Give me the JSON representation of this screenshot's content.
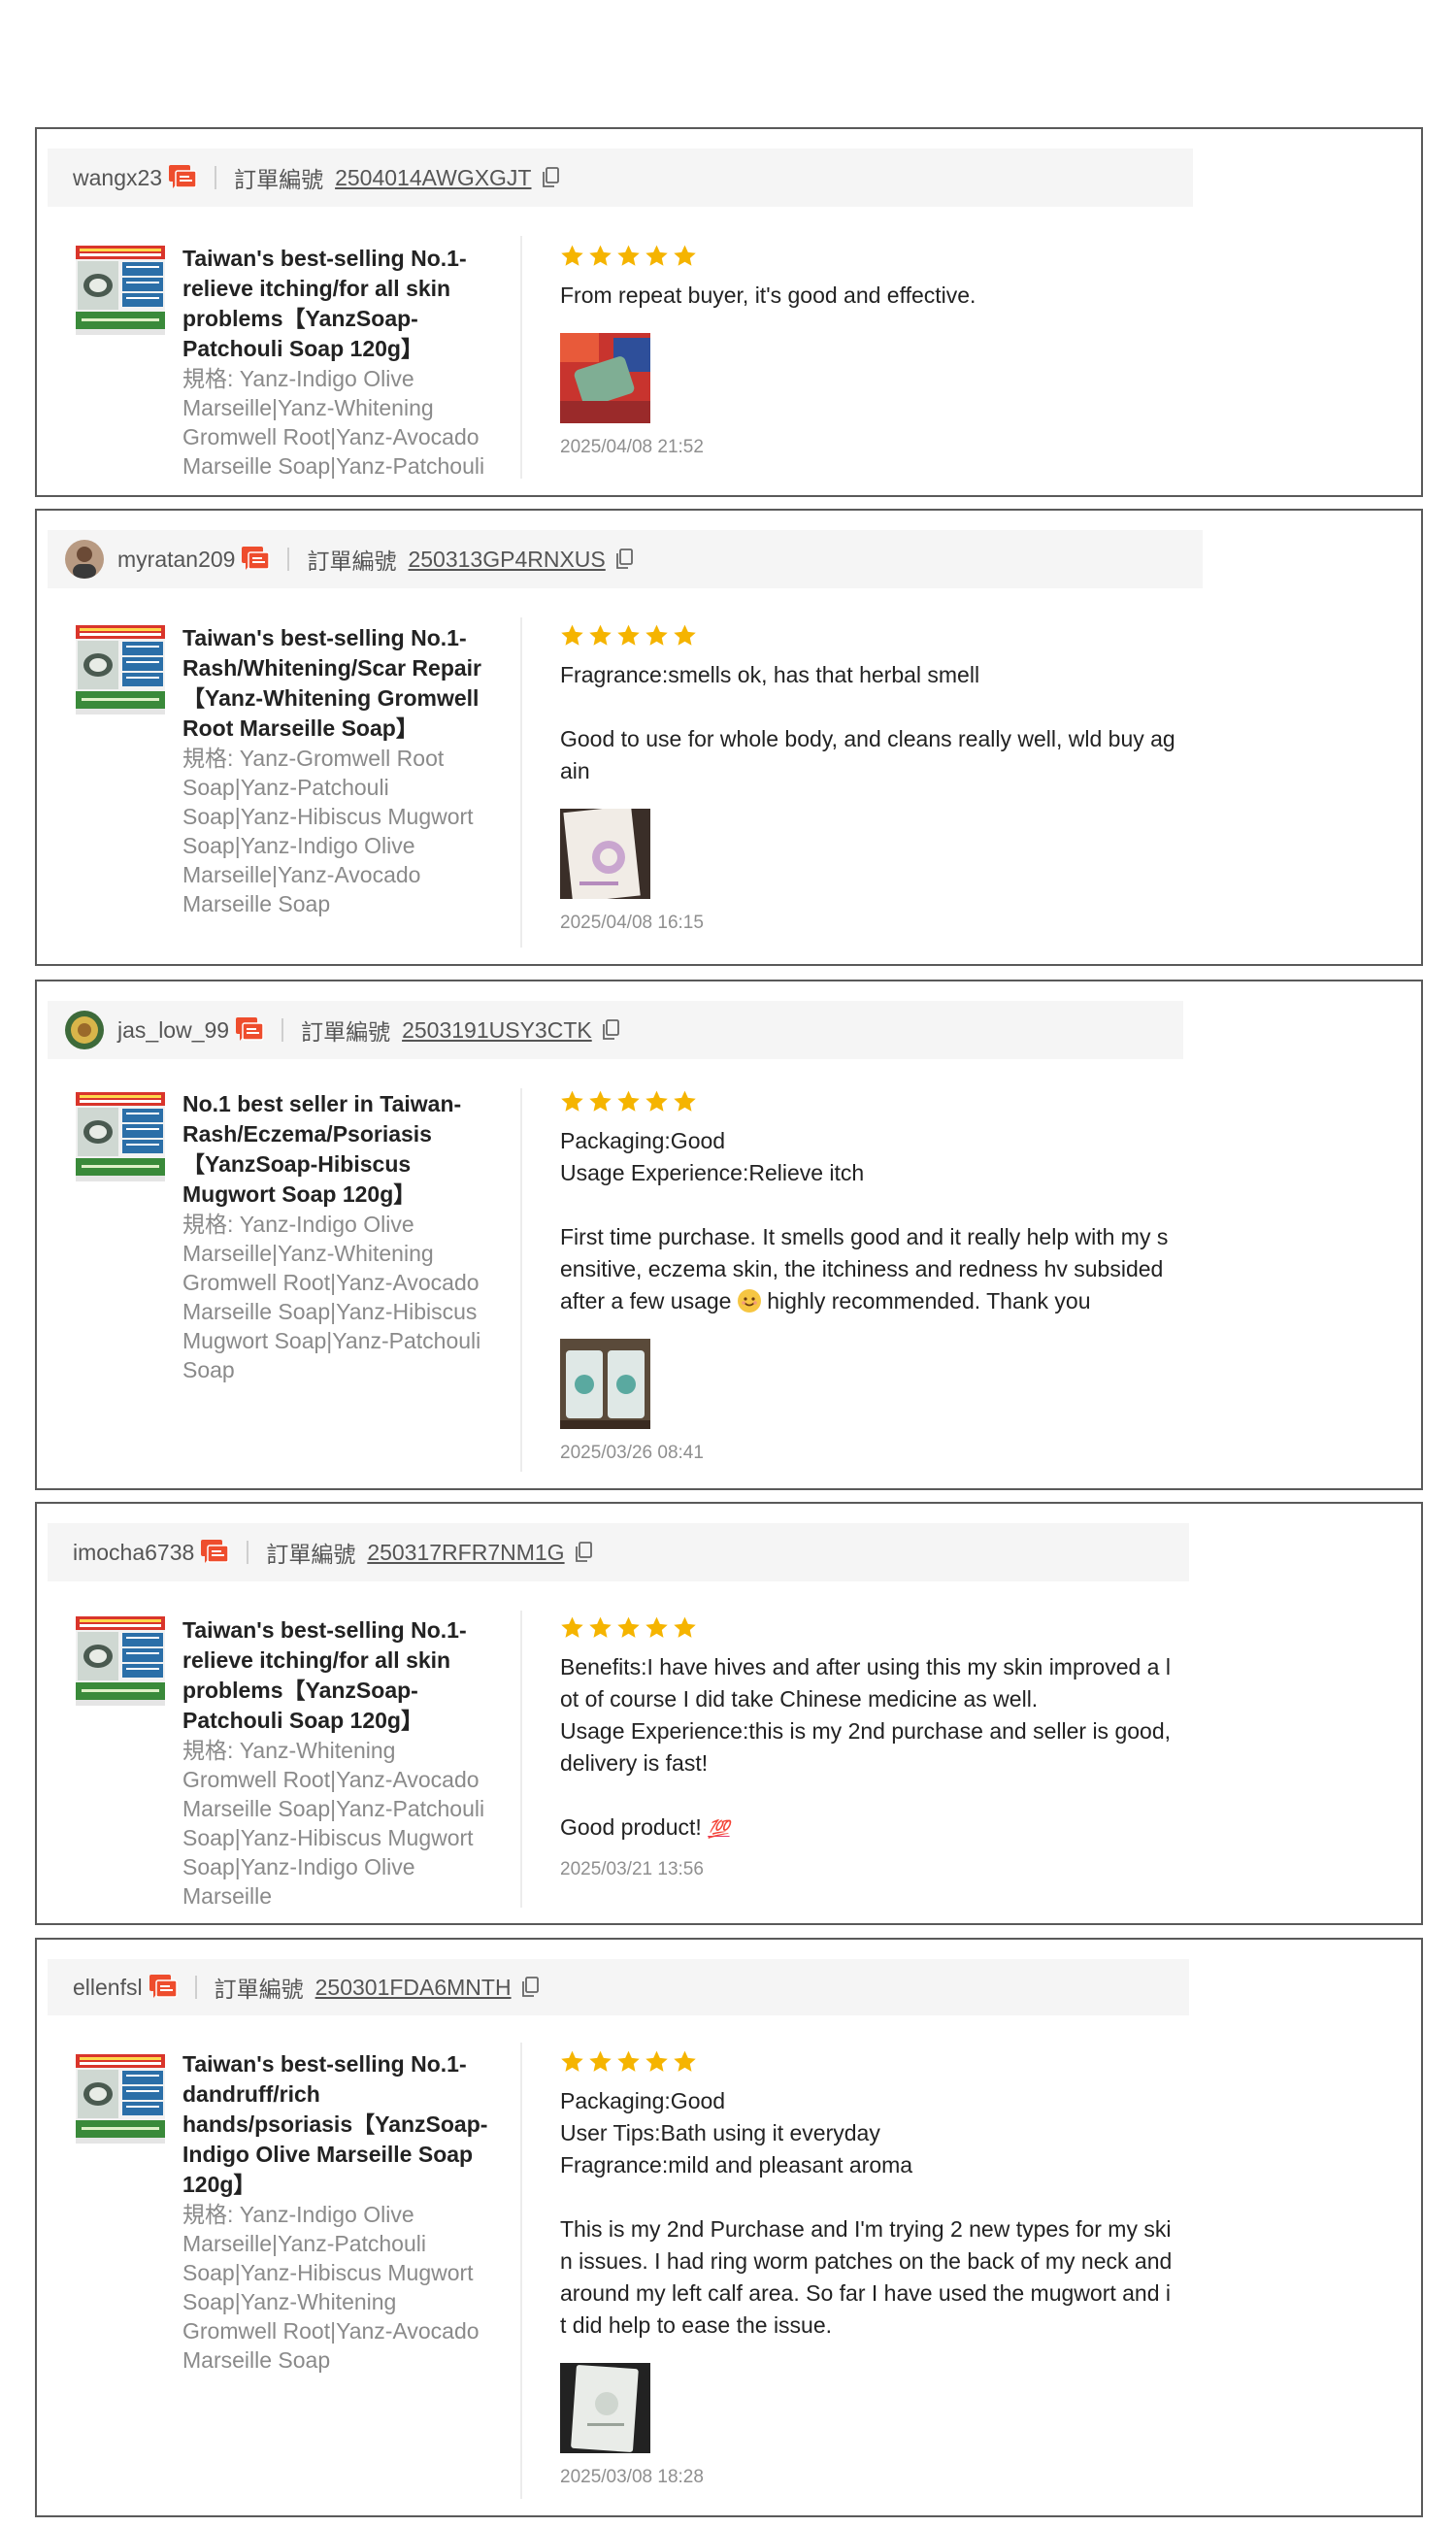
{
  "order_label": "訂單編號",
  "reviews": [
    {
      "username": "wangx23",
      "order_id": "2504014AWGXGJT",
      "product_name": "Taiwan's best-selling No.1-relieve itching/for all skin problems【YanzSoap-Patchouli Soap 120g】",
      "variation": "規格: Yanz-Indigo Olive Marseille|Yanz-Whitening Gromwell Root|Yanz-Avocado Marseille Soap|Yanz-Patchouli Soap|Ya",
      "rating": 5,
      "text": "From repeat buyer, it's good and effective.",
      "date": "2025/04/08 21:52"
    },
    {
      "username": "myratan209",
      "order_id": "250313GP4RNXUS",
      "product_name": "Taiwan's best-selling No.1-Rash/Whitening/Scar Repair【Yanz-Whitening Gromwell Root Marseille Soap】",
      "variation": "規格: Yanz-Gromwell Root Soap|Yanz-Patchouli Soap|Yanz-Hibiscus Mugwort Soap|Yanz-Indigo Olive Marseille|Yanz-Avocado Marseille Soap",
      "rating": 5,
      "text": "Fragrance:smells ok, has that herbal smell\n\nGood to use for whole body, and cleans really well, wld buy again",
      "date": "2025/04/08 16:15"
    },
    {
      "username": "jas_low_99",
      "order_id": "2503191USY3CTK",
      "product_name": "No.1 best seller in Taiwan-Rash/Eczema/Psoriasis【YanzSoap-Hibiscus Mugwort Soap 120g】",
      "variation": "規格: Yanz-Indigo Olive Marseille|Yanz-Whitening Gromwell Root|Yanz-Avocado Marseille Soap|Yanz-Hibiscus Mugwort Soap|Yanz-Patchouli Soap",
      "rating": 5,
      "text_before_emoji": "Packaging:Good\nUsage Experience:Relieve itch\n\nFirst time purchase. It smells good and it really help with my sensitive, eczema skin, the itchiness and redness hv subsided after a few usage ",
      "text_after_emoji": " highly recommended. Thank you",
      "date": "2025/03/26 08:41"
    },
    {
      "username": "imocha6738",
      "order_id": "250317RFR7NM1G",
      "product_name": "Taiwan's best-selling No.1-relieve itching/for all skin problems【YanzSoap-Patchouli Soap 120g】",
      "variation": "規格: Yanz-Whitening Gromwell Root|Yanz-Avocado Marseille Soap|Yanz-Patchouli Soap|Yanz-Hibiscus Mugwort Soap|Yanz-Indigo Olive Marseille",
      "rating": 5,
      "text_before_emoji": "Benefits:I have hives and after using this my skin improved a lot of course I did take Chinese medicine as well.\nUsage Experience:this is my 2nd purchase and seller is good, delivery is fast!\n\nGood product! ",
      "emoji_100": "💯",
      "date": "2025/03/21 13:56"
    },
    {
      "username": "ellenfsl",
      "order_id": "250301FDA6MNTH",
      "product_name": "Taiwan's best-selling No.1-dandruff/rich hands/psoriasis【YanzSoap-Indigo Olive Marseille Soap 120g】",
      "variation": "規格: Yanz-Indigo Olive Marseille|Yanz-Patchouli Soap|Yanz-Hibiscus Mugwort Soap|Yanz-Whitening Gromwell Root|Yanz-Avocado Marseille Soap",
      "rating": 5,
      "text": "Packaging:Good\nUser Tips:Bath using it everyday\nFragrance:mild and pleasant aroma\n\nThis is my 2nd Purchase and I'm trying 2 new types for my skin issues. I had ring worm patches on the back of my neck and around my left calf area. So far I have used the mugwort and it did help to ease the issue.",
      "date": "2025/03/08 18:28"
    }
  ]
}
